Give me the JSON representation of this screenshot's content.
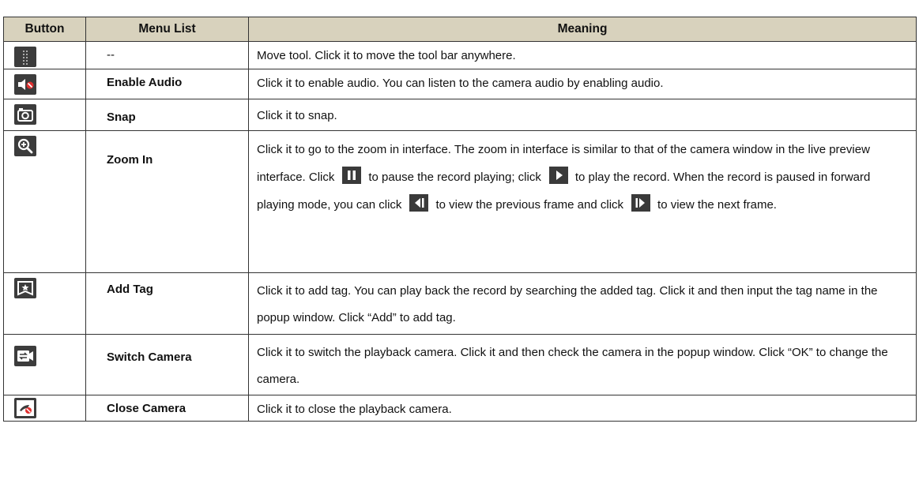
{
  "table": {
    "headers": {
      "button": "Button",
      "menu": "Menu List",
      "meaning": "Meaning"
    },
    "rows": [
      {
        "icon": "move-tool-icon",
        "menu": "--",
        "meaning": "Move tool. Click it to move the tool bar anywhere."
      },
      {
        "icon": "audio-muted-icon",
        "menu": "Enable Audio",
        "meaning": "Click it to enable audio. You can listen to the camera audio by enabling audio."
      },
      {
        "icon": "camera-snap-icon",
        "menu": "Snap",
        "meaning": "Click it to snap."
      },
      {
        "icon": "zoom-in-icon",
        "menu": "Zoom In",
        "meaning_parts": [
          "Click it to go to the zoom in interface. The zoom in interface is similar to that of the camera window in the live preview interface. Click",
          "to pause the record playing; click",
          "to play the record. When the record is paused in forward playing mode, you can click",
          "to view the previous frame and click",
          "to view the next frame."
        ]
      },
      {
        "icon": "tag-icon",
        "menu": "Add Tag",
        "meaning": "Click it to add tag. You can play back the record by searching the added tag. Click it and then input the tag name in the popup window. Click “Add” to add tag."
      },
      {
        "icon": "switch-camera-icon",
        "menu": "Switch Camera",
        "meaning": "Click it to switch the playback camera. Click it and then check the camera in the popup window. Click “OK” to change the camera."
      },
      {
        "icon": "close-camera-icon",
        "menu": "Close Camera",
        "meaning": "Click it to close the playback camera."
      }
    ]
  }
}
